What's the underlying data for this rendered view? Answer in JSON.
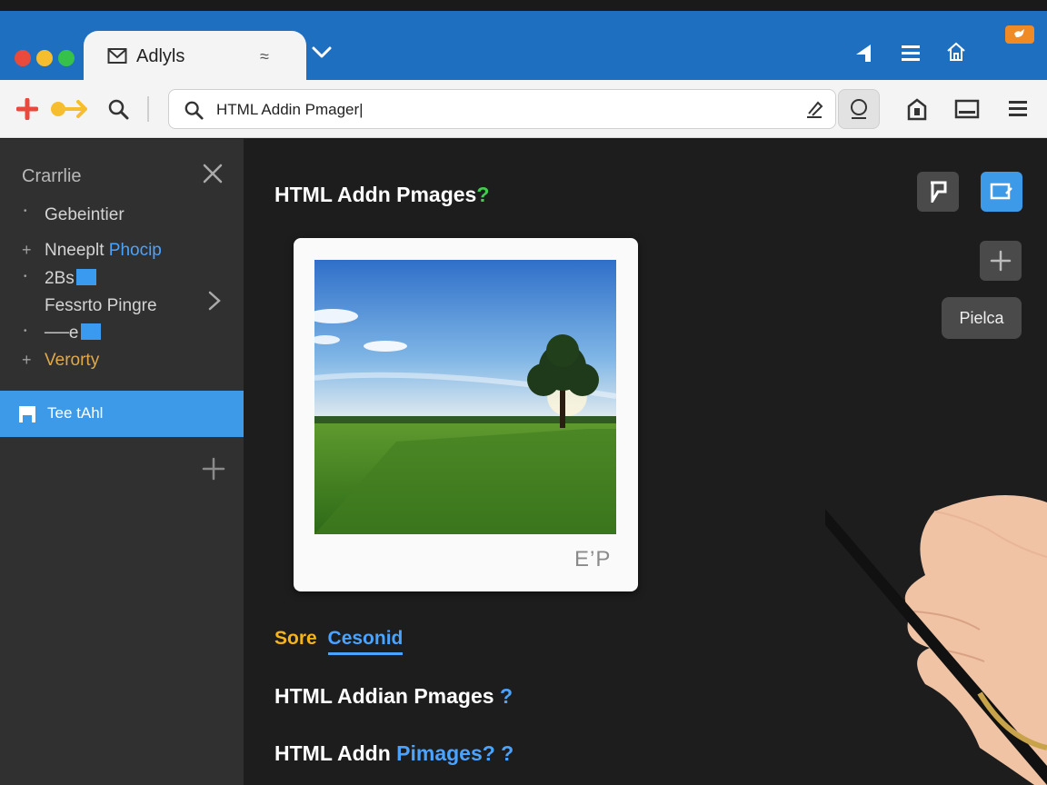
{
  "window": {
    "traffic_lights": [
      "#e84b3c",
      "#f6be2f",
      "#36c24a"
    ],
    "titlebar_color": "#1f6fc0",
    "active_tab": {
      "label": "Adlyls",
      "close_glyph": "≈"
    },
    "titlebar_icons": [
      "pin-icon",
      "menu-icon",
      "home-icon"
    ],
    "badge_icon": "twitter-bird-icon"
  },
  "navbar": {
    "icons": [
      "add-icon",
      "forward-icon",
      "search-icon"
    ],
    "url": "HTML Addin Pmager|",
    "right_icons": [
      "lock-icon",
      "window-icon",
      "menu-icon"
    ]
  },
  "sidebar": {
    "title": "Crarrlie",
    "items": [
      {
        "text": "Gebeintier",
        "bullet": "•"
      },
      {
        "text": "Nneeplt",
        "accent": "Phocip",
        "bullet": "+"
      },
      {
        "text": "2Bs",
        "bullet": "•"
      },
      {
        "text": "Fessrto Pingre"
      },
      {
        "text": "──e",
        "bullet": "•"
      },
      {
        "text": "Verorty",
        "bullet": "+"
      }
    ],
    "selected": "Tee tAhl"
  },
  "main": {
    "heading": "HTML Addn Pmages",
    "heading_mark": "?",
    "piece_button": "Pielca",
    "photo_mark": "E’P",
    "tabs": {
      "first": "Sore",
      "second": "Cesonid"
    },
    "line1": {
      "text": "HTML Addian Pmages",
      "mark": "?"
    },
    "line2": {
      "text": "HTML Addn",
      "accent": "Pimages? ?"
    }
  },
  "colors": {
    "accent_blue": "#3d9ae8",
    "accent_orange": "#f4b41a",
    "accent_green": "#3fcf4c"
  }
}
